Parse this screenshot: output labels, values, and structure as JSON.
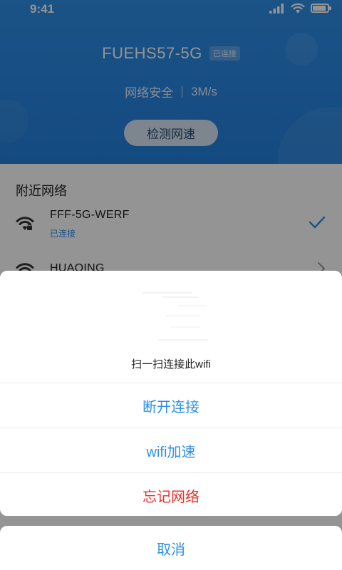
{
  "status_bar": {
    "time": "9:41"
  },
  "header": {
    "ssid": "FUEHS57-5G",
    "connected_badge": "已连接",
    "security": "网络安全",
    "speed": "3M/s",
    "speed_test_button": "检测网速"
  },
  "nearby": {
    "title": "附近网络",
    "networks": [
      {
        "name": "FFF-5G-WERF",
        "status": "已连接",
        "icon": "wifi-locked-icon",
        "action": "check-icon"
      },
      {
        "name": "HUAQING",
        "icon": "wifi-icon",
        "action": "chevron-right-icon"
      }
    ]
  },
  "sheet": {
    "qr_caption": "扫一扫连接此wifi",
    "actions": [
      {
        "label": "断开连接",
        "color": "#2f8fe8"
      },
      {
        "label": "wifi加速",
        "color": "#2f8fe8"
      },
      {
        "label": "忘记网络",
        "color": "#e8302c"
      }
    ],
    "cancel": "取消"
  },
  "colors": {
    "accent": "#2f8fe8",
    "danger": "#e8302c",
    "header_bg": "#2380dd"
  }
}
